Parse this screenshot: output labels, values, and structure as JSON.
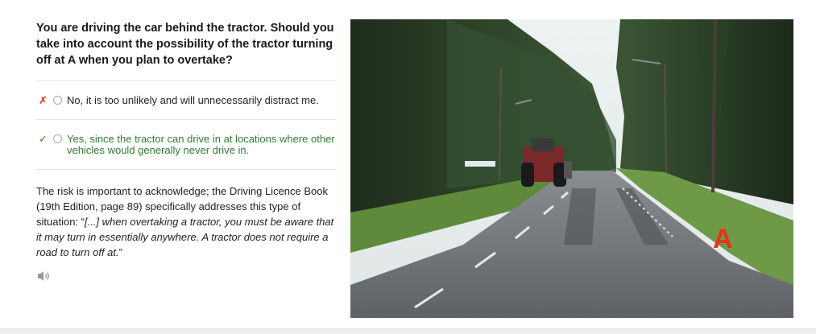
{
  "question": {
    "text": "You are driving the car behind the tractor. Should you take into account the possibility of the tractor turning off at A when you plan to overtake?"
  },
  "options": [
    {
      "mark": "✗",
      "status": "incorrect",
      "text": "No, it is too unlikely and will unnecessarily distract me."
    },
    {
      "mark": "✓",
      "status": "correct",
      "text": "Yes, since the tractor can drive in at locations where other vehicles would generally never drive in."
    }
  ],
  "explanation": {
    "intro": "The risk is important to acknowledge; the Driving Licence Book (19th Edition, page 89) specifically addresses this type of situation: “",
    "quote": "[...] when overtaking a tractor, you must be aware that it may turn in essentially anywhere. A tractor does not require a road to turn off at.",
    "outro": "”"
  },
  "image": {
    "marker_label": "A",
    "marker_color": "#e8321e"
  },
  "icons": {
    "audio": "speaker-icon",
    "wrong": "cross-icon",
    "right": "check-icon"
  },
  "colors": {
    "correct": "#2e7d32",
    "wrong_mark": "#d9302b"
  }
}
